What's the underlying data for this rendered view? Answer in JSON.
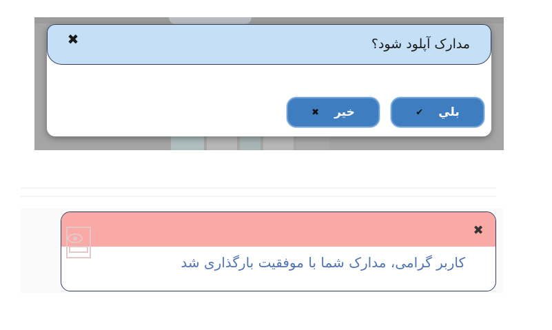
{
  "confirm_dialog": {
    "title": "مدارک آپلود شود؟",
    "close_glyph": "✖",
    "yes_button": {
      "label": "بلي",
      "icon": "check-icon",
      "glyph": "✔"
    },
    "no_button": {
      "label": "خير",
      "icon": "close-icon",
      "glyph": "✖"
    },
    "colors": {
      "header_bg": "#c5e0f6",
      "button_bg": "#3d7dc0"
    }
  },
  "success_notification": {
    "message": "کاربر گرامی، مدارک شما با موفقیت بارگذاری شد",
    "close_glyph": "✖",
    "colors": {
      "bar_bg": "#f9aaa6",
      "text": "#4f73b5"
    }
  }
}
